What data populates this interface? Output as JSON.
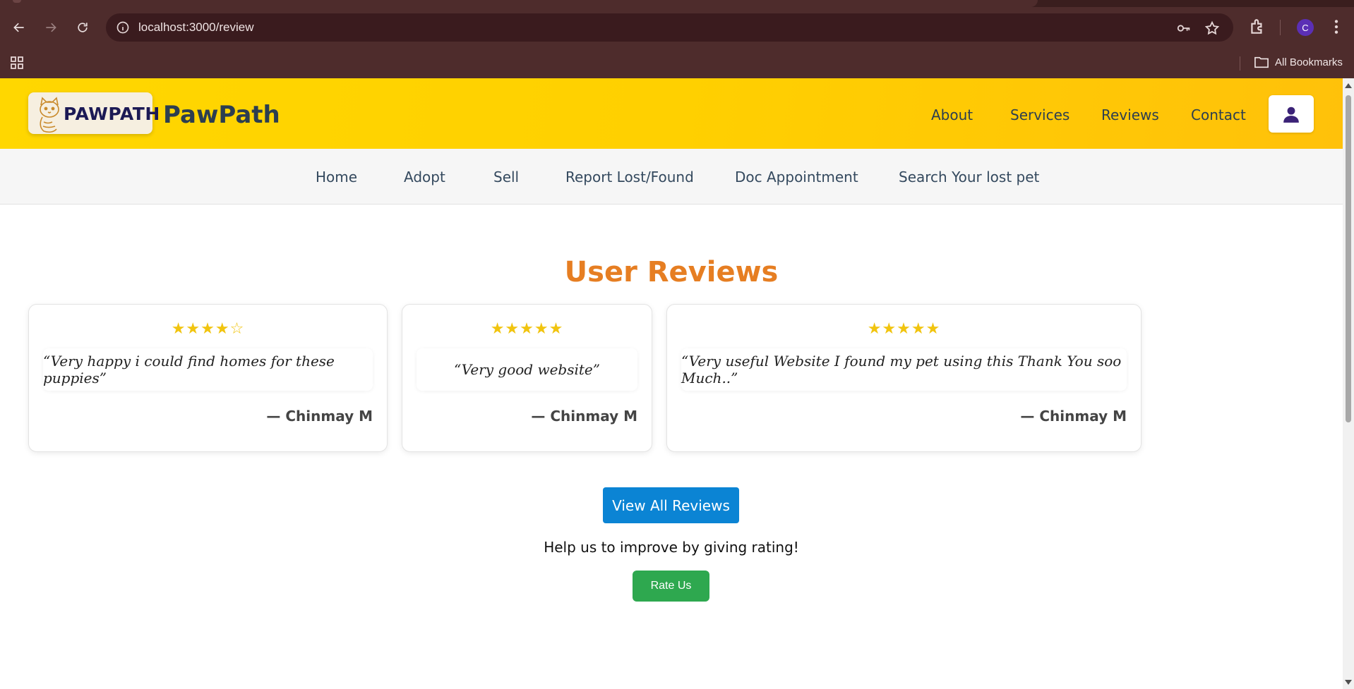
{
  "browser": {
    "url": "localhost:3000/review",
    "bookmarks_label": "All Bookmarks",
    "profile_initial": "C"
  },
  "header": {
    "logo_text": "PAWPATH",
    "brand": "PawPath",
    "nav": [
      "About",
      "Services",
      "Reviews",
      "Contact"
    ]
  },
  "sub_nav": [
    "Home",
    "Adopt",
    "Sell",
    "Report Lost/Found",
    "Doc Appointment",
    "Search Your lost pet"
  ],
  "reviews": {
    "title": "User Reviews",
    "items": [
      {
        "stars": "★★★★☆",
        "rating": 4,
        "text": "“Very happy i could find homes for these puppies”",
        "author": "— Chinmay M"
      },
      {
        "stars": "★★★★★",
        "rating": 5,
        "text": "“Very good website”",
        "author": "— Chinmay M"
      },
      {
        "stars": "★★★★★",
        "rating": 5,
        "text": "“Very useful Website I found my pet using this Thank You soo Much..”",
        "author": "— Chinmay M"
      }
    ],
    "view_all_label": "View All Reviews",
    "help_text": "Help us to improve by giving rating!",
    "rate_label": "Rate Us"
  },
  "colors": {
    "header_bg": "#ffd000",
    "title": "#e67e22",
    "star": "#f1c40f",
    "primary_button": "#0b84d4",
    "rate_button": "#2ea84f",
    "browser_chrome": "#4e2c2c"
  }
}
